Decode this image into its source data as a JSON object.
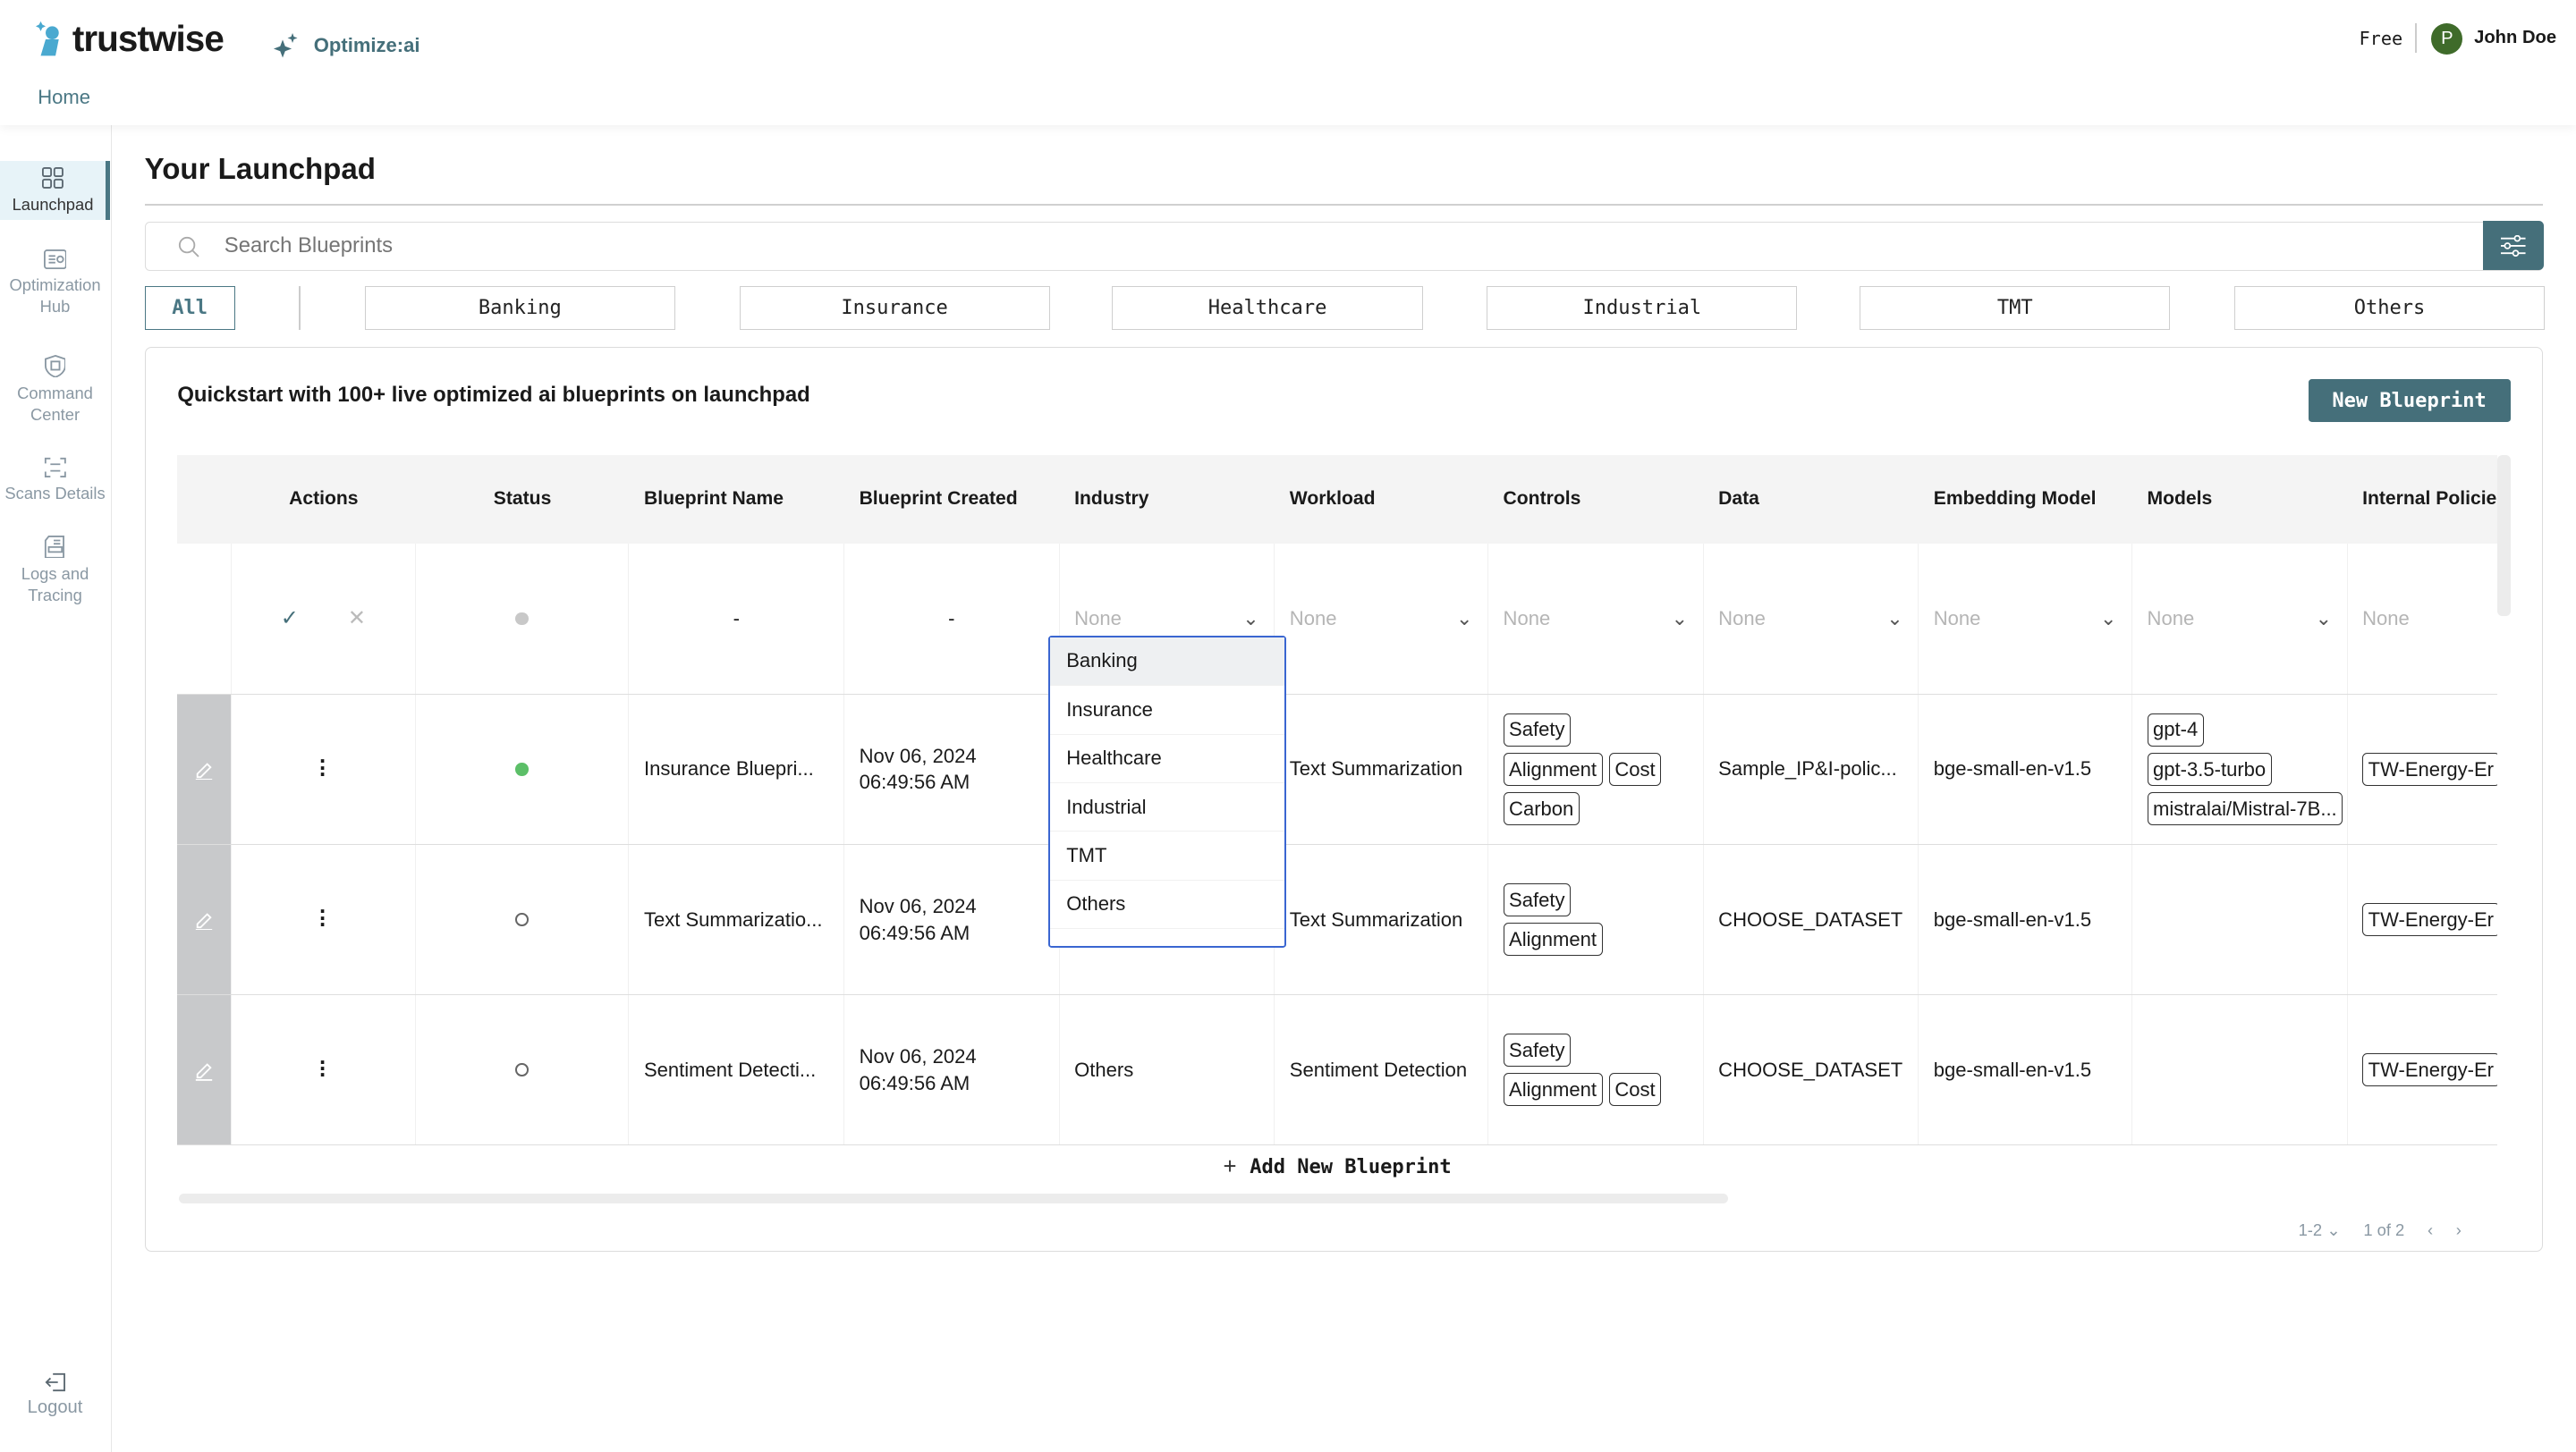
{
  "header": {
    "brand": "trustwise",
    "product": "Optimize:ai",
    "breadcrumb": "Home",
    "plan": "Free",
    "user": {
      "initial": "P",
      "name": "John Doe",
      "avatar_color": "#3f6b2a"
    }
  },
  "sidebar": {
    "items": [
      {
        "label": "Launchpad",
        "icon": "grid-icon",
        "active": true
      },
      {
        "label": "Optimization Hub",
        "icon": "dashboard-icon"
      },
      {
        "label": "Command Center",
        "icon": "shield-chip-icon"
      },
      {
        "label": "Scans Details",
        "icon": "scan-icon"
      },
      {
        "label": "Logs and Tracing",
        "icon": "logs-icon"
      }
    ],
    "logout": "Logout"
  },
  "page": {
    "title": "Your Launchpad",
    "search_placeholder": "Search Blueprints"
  },
  "categories": [
    "All",
    "Banking",
    "Insurance",
    "Healthcare",
    "Industrial",
    "TMT",
    "Others"
  ],
  "card": {
    "title": "Quickstart with 100+ live optimized ai blueprints on launchpad",
    "new_button": "New Blueprint",
    "add_row": "Add New Blueprint"
  },
  "table": {
    "columns": [
      "Actions",
      "Status",
      "Blueprint Name",
      "Blueprint Created",
      "Industry",
      "Workload",
      "Controls",
      "Data",
      "Embedding Model",
      "Models",
      "Internal Policie"
    ],
    "new_row": {
      "name": "-",
      "created": "-",
      "placeholder": "None"
    },
    "rows": [
      {
        "status": "active",
        "name": "Insurance Bluepri...",
        "date": "Nov 06, 2024",
        "time": "06:49:56 AM",
        "industry": "",
        "workload": "Text Summarization",
        "controls": [
          "Safety",
          "Alignment",
          "Cost",
          "Carbon"
        ],
        "data": "Sample_IP&I-polic...",
        "embedding": "bge-small-en-v1.5",
        "models": [
          "gpt-4",
          "gpt-3.5-turbo",
          "mistralai/Mistral-7B..."
        ],
        "policy": "TW-Energy-Er"
      },
      {
        "status": "inactive",
        "name": "Text Summarizatio...",
        "date": "Nov 06, 2024",
        "time": "06:49:56 AM",
        "industry": "",
        "workload": "Text Summarization",
        "controls": [
          "Safety",
          "Alignment"
        ],
        "data": "CHOOSE_DATASET",
        "embedding": "bge-small-en-v1.5",
        "models": [],
        "policy": "TW-Energy-Er"
      },
      {
        "status": "inactive",
        "name": "Sentiment Detecti...",
        "date": "Nov 06, 2024",
        "time": "06:49:56 AM",
        "industry": "Others",
        "workload": "Sentiment Detection",
        "controls": [
          "Safety",
          "Alignment",
          "Cost"
        ],
        "data": "CHOOSE_DATASET",
        "embedding": "bge-small-en-v1.5",
        "models": [],
        "policy": "TW-Energy-Er"
      }
    ]
  },
  "dropdown": {
    "options": [
      "Banking",
      "Insurance",
      "Healthcare",
      "Industrial",
      "TMT",
      "Others"
    ],
    "highlighted": "Banking"
  },
  "pagination": {
    "range": "1-2",
    "page": "1 of 2"
  },
  "colors": {
    "accent": "#456f7a",
    "active_status": "#5cbf68",
    "dropdown_border": "#3a66d1"
  }
}
